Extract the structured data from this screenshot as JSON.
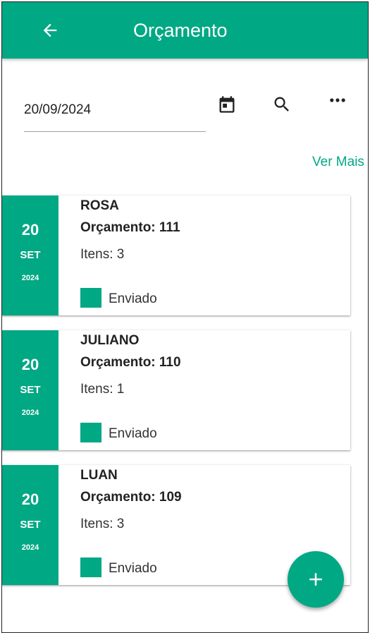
{
  "appbar": {
    "title": "Orçamento",
    "back_icon": "arrow-back-icon"
  },
  "filter": {
    "date_value": "20/09/2024",
    "calendar_icon": "calendar-icon",
    "search_icon": "search-icon",
    "more_icon": "more-horizontal-icon"
  },
  "ver_mais": "Ver Mais",
  "cards": [
    {
      "day": "20",
      "month": "SET",
      "year": "2024",
      "client": "ROSA",
      "orcamento": "Orçamento: 111",
      "itens": "Itens: 3",
      "status": "Enviado"
    },
    {
      "day": "20",
      "month": "SET",
      "year": "2024",
      "client": "JULIANO",
      "orcamento": "Orçamento: 110",
      "itens": "Itens: 1",
      "status": "Enviado"
    },
    {
      "day": "20",
      "month": "SET",
      "year": "2024",
      "client": "LUAN",
      "orcamento": "Orçamento: 109",
      "itens": "Itens: 3",
      "status": "Enviado"
    }
  ],
  "fab": {
    "icon": "plus-icon"
  },
  "colors": {
    "primary": "#00a884",
    "text": "#222222"
  }
}
